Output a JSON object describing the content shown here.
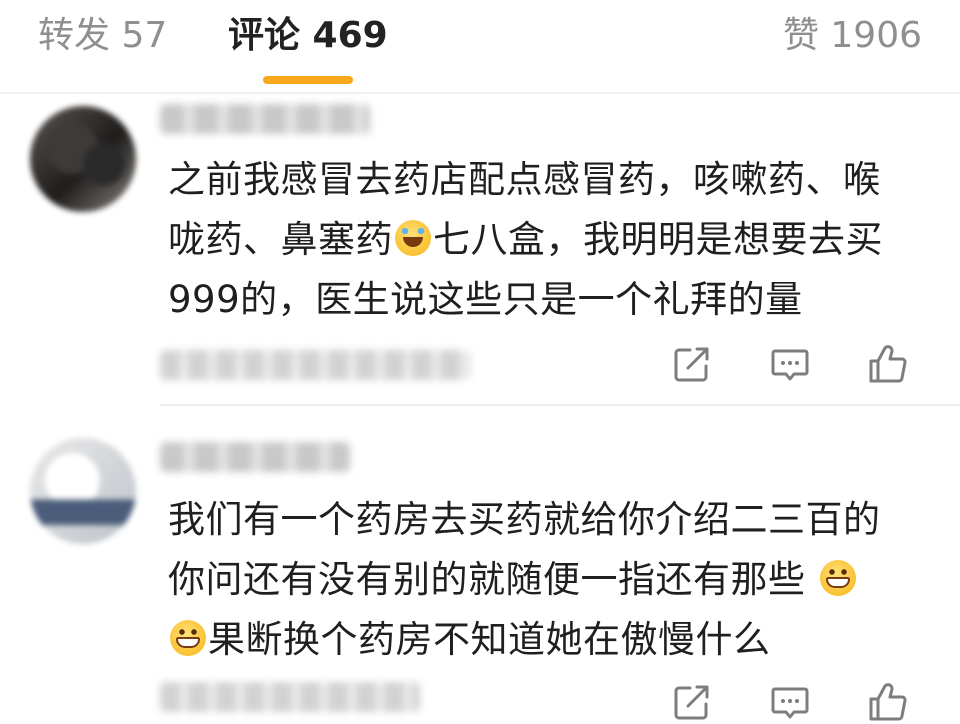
{
  "tabs": {
    "reposts_label": "转发 57",
    "comments_label": "评论 469",
    "likes_label": "赞 1906",
    "active": "comments",
    "indicator_color": "#f7a81b"
  },
  "comments": [
    {
      "username": "",
      "text_lines": [
        {
          "before": "之前我感冒去药店配点感冒药，咳嗽药、喉",
          "emoji": "",
          "after": ""
        },
        {
          "before": "咙药、鼻塞药",
          "emoji": "laughing-with-tears-emoji",
          "after": "七八盒，我明明是想要去买"
        },
        {
          "before": "999的，医生说这些只是一个礼拜的量",
          "emoji": "",
          "after": ""
        }
      ],
      "meta": "",
      "actions": [
        "share-icon",
        "comment-icon",
        "like-icon"
      ]
    },
    {
      "username": "",
      "text_lines": [
        {
          "before": "我们有一个药房去买药就给你介绍二三百的",
          "emoji": "",
          "after": ""
        },
        {
          "before": "你问还有没有别的就随便一指还有那些 ",
          "emoji": "grinning-emoji",
          "after": ""
        },
        {
          "before": "",
          "emoji": "grinning-emoji",
          "after": "果断换个药房不知道她在傲慢什么"
        }
      ],
      "meta": "",
      "actions": [
        "share-icon",
        "comment-icon",
        "like-icon"
      ]
    }
  ],
  "colors": {
    "text": "#1f1f1f",
    "muted": "#8f8f8f",
    "icon": "#7d7d7d"
  }
}
